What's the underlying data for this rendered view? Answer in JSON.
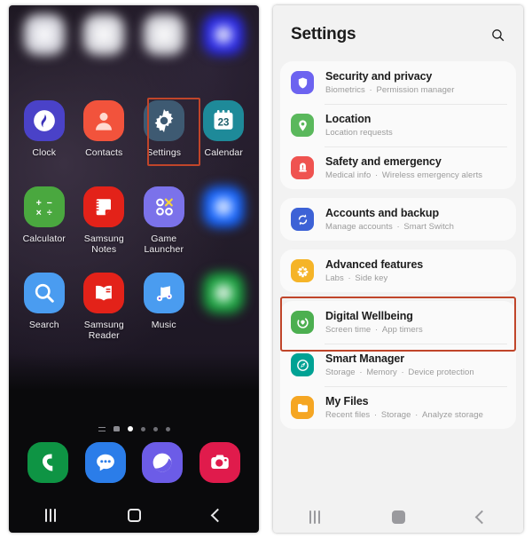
{
  "left_phone": {
    "name": "home-screen",
    "app_rows": [
      [
        {
          "label": "",
          "icon": "blurred-app-icon",
          "blurred": true,
          "color": "#d8d8e0"
        },
        {
          "label": "",
          "icon": "blurred-app-icon",
          "blurred": true,
          "color": "#dcdce2"
        },
        {
          "label": "",
          "icon": "blurred-app-icon",
          "blurred": true,
          "color": "#dadae0"
        },
        {
          "label": "",
          "icon": "blurred-app-icon",
          "blurred": true,
          "color": "#2a2ae8"
        }
      ],
      [
        {
          "label": "Clock",
          "icon": "clock-icon",
          "blurred": false,
          "color": "#4a42c8"
        },
        {
          "label": "Contacts",
          "icon": "contacts-icon",
          "blurred": false,
          "color": "#f2533c"
        },
        {
          "label": "Settings",
          "icon": "settings-gear-icon",
          "blurred": false,
          "color": "#3e5a72",
          "selected": true
        },
        {
          "label": "Calendar",
          "icon": "calendar-icon",
          "blurred": false,
          "color": "#1e8a99"
        }
      ],
      [
        {
          "label": "Calculator",
          "icon": "calculator-icon",
          "blurred": false,
          "color": "#4aa83f"
        },
        {
          "label": "Samsung Notes",
          "icon": "samsung-notes-icon",
          "blurred": false,
          "color": "#e32219"
        },
        {
          "label": "Game Launcher",
          "icon": "game-launcher-icon",
          "blurred": false,
          "color": "#7b72ea"
        },
        {
          "label": "",
          "icon": "blurred-app-icon",
          "blurred": true,
          "color": "#1565ff"
        }
      ],
      [
        {
          "label": "Search",
          "icon": "search-icon",
          "blurred": false,
          "color": "#4a9cf0"
        },
        {
          "label": "Samsung Reader",
          "icon": "samsung-reader-icon",
          "blurred": false,
          "color": "#e32219"
        },
        {
          "label": "Music",
          "icon": "music-icon",
          "blurred": false,
          "color": "#4a9cf0"
        },
        {
          "label": "",
          "icon": "blurred-app-icon",
          "blurred": true,
          "color": "#1aa33f"
        }
      ]
    ],
    "page_dots": {
      "count": 6,
      "active_index": 2
    },
    "dock": [
      {
        "label": "Phone",
        "icon": "phone-icon",
        "color": "#0e9444"
      },
      {
        "label": "Messages",
        "icon": "messages-icon",
        "color": "#2b7de9"
      },
      {
        "label": "Internet",
        "icon": "internet-browser-icon",
        "color": "#6c5ce7"
      },
      {
        "label": "Camera",
        "icon": "camera-icon",
        "color": "#e01b4c"
      }
    ],
    "nav_bar": {
      "recents_label": "Recents",
      "home_label": "Home",
      "back_label": "Back"
    },
    "selection_highlight": {
      "target": "Settings",
      "color": "#c0452a"
    }
  },
  "right_phone": {
    "name": "settings-screen",
    "header": {
      "title": "Settings",
      "search_icon": "search-icon"
    },
    "groups": [
      {
        "items": [
          {
            "title": "Security and privacy",
            "subtitle_parts": [
              "Biometrics",
              "Permission manager"
            ],
            "icon": "shield-icon",
            "color": "#6c63f0"
          },
          {
            "title": "Location",
            "subtitle_parts": [
              "Location requests"
            ],
            "icon": "location-pin-icon",
            "color": "#5ab85c"
          },
          {
            "title": "Safety and emergency",
            "subtitle_parts": [
              "Medical info",
              "Wireless emergency alerts"
            ],
            "icon": "emergency-siren-icon",
            "color": "#ef5350"
          }
        ]
      },
      {
        "items": [
          {
            "title": "Accounts and backup",
            "subtitle_parts": [
              "Manage accounts",
              "Smart Switch"
            ],
            "icon": "sync-refresh-icon",
            "color": "#3d62d6"
          }
        ]
      },
      {
        "highlighted": true,
        "items": [
          {
            "title": "Advanced features",
            "subtitle_parts": [
              "Labs",
              "Side key"
            ],
            "icon": "advanced-features-icon",
            "color": "#f5b428"
          }
        ]
      },
      {
        "items": [
          {
            "title": "Digital Wellbeing",
            "subtitle_parts": [
              "Screen time",
              "App timers"
            ],
            "icon": "digital-wellbeing-icon",
            "color": "#4caf50"
          },
          {
            "title": "Smart Manager",
            "subtitle_parts": [
              "Storage",
              "Memory",
              "Device protection"
            ],
            "icon": "smart-manager-icon",
            "color": "#00a294"
          },
          {
            "title": "My Files",
            "subtitle_parts": [
              "Recent files",
              "Storage",
              "Analyze storage"
            ],
            "icon": "folder-icon",
            "color": "#f5a623"
          }
        ]
      }
    ],
    "nav_bar": {
      "recents_label": "Recents",
      "home_label": "Home",
      "back_label": "Back"
    },
    "selection_highlight": {
      "target": "Advanced features",
      "color": "#c0452a"
    }
  }
}
